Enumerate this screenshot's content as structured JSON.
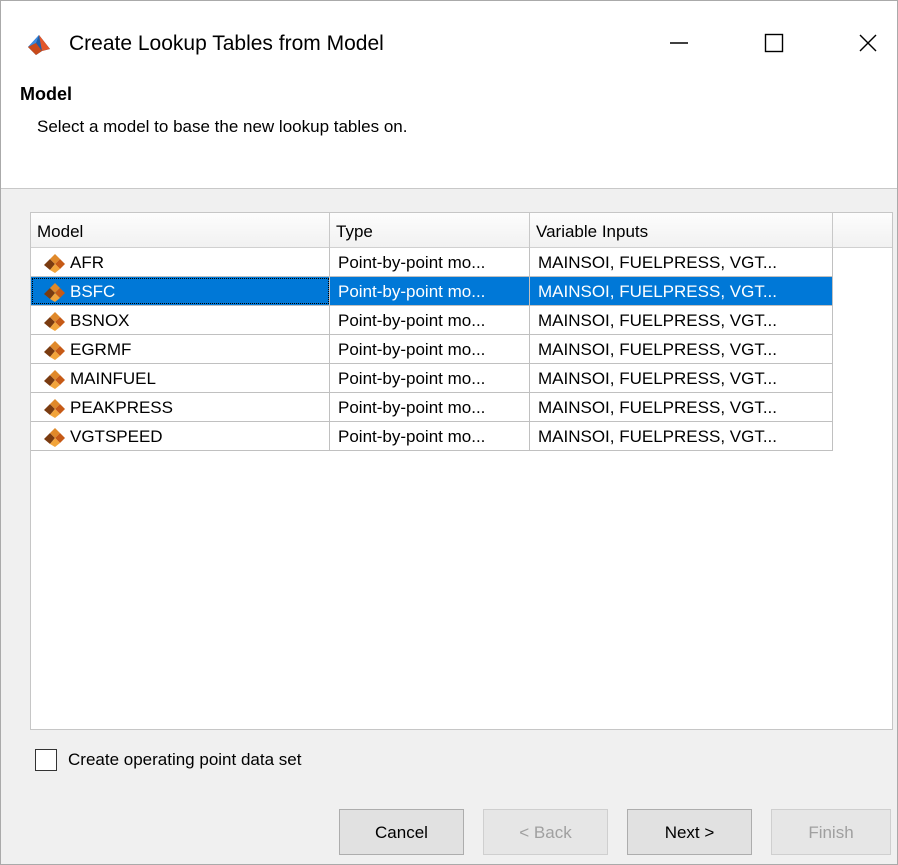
{
  "window": {
    "title": "Create Lookup Tables from Model",
    "icon": "matlab-icon"
  },
  "header": {
    "section_title": "Model",
    "description": "Select a model to base the new lookup tables on."
  },
  "table": {
    "columns": [
      "Model",
      "Type",
      "Variable Inputs"
    ],
    "selected_index": 1,
    "rows": [
      {
        "model": "AFR",
        "type": "Point-by-point mo...",
        "inputs": "MAINSOI, FUELPRESS, VGT..."
      },
      {
        "model": "BSFC",
        "type": "Point-by-point mo...",
        "inputs": "MAINSOI, FUELPRESS, VGT..."
      },
      {
        "model": "BSNOX",
        "type": "Point-by-point mo...",
        "inputs": "MAINSOI, FUELPRESS, VGT..."
      },
      {
        "model": "EGRMF",
        "type": "Point-by-point mo...",
        "inputs": "MAINSOI, FUELPRESS, VGT..."
      },
      {
        "model": "MAINFUEL",
        "type": "Point-by-point mo...",
        "inputs": "MAINSOI, FUELPRESS, VGT..."
      },
      {
        "model": "PEAKPRESS",
        "type": "Point-by-point mo...",
        "inputs": "MAINSOI, FUELPRESS, VGT..."
      },
      {
        "model": "VGTSPEED",
        "type": "Point-by-point mo...",
        "inputs": "MAINSOI, FUELPRESS, VGT..."
      }
    ]
  },
  "options": {
    "operating_point_label": "Create operating point data set",
    "operating_point_checked": false
  },
  "buttons": {
    "cancel": "Cancel",
    "back": "< Back",
    "next": "Next >",
    "finish": "Finish"
  },
  "colors": {
    "selection": "#0078d7",
    "dialog_bg": "#f0f0f0"
  }
}
